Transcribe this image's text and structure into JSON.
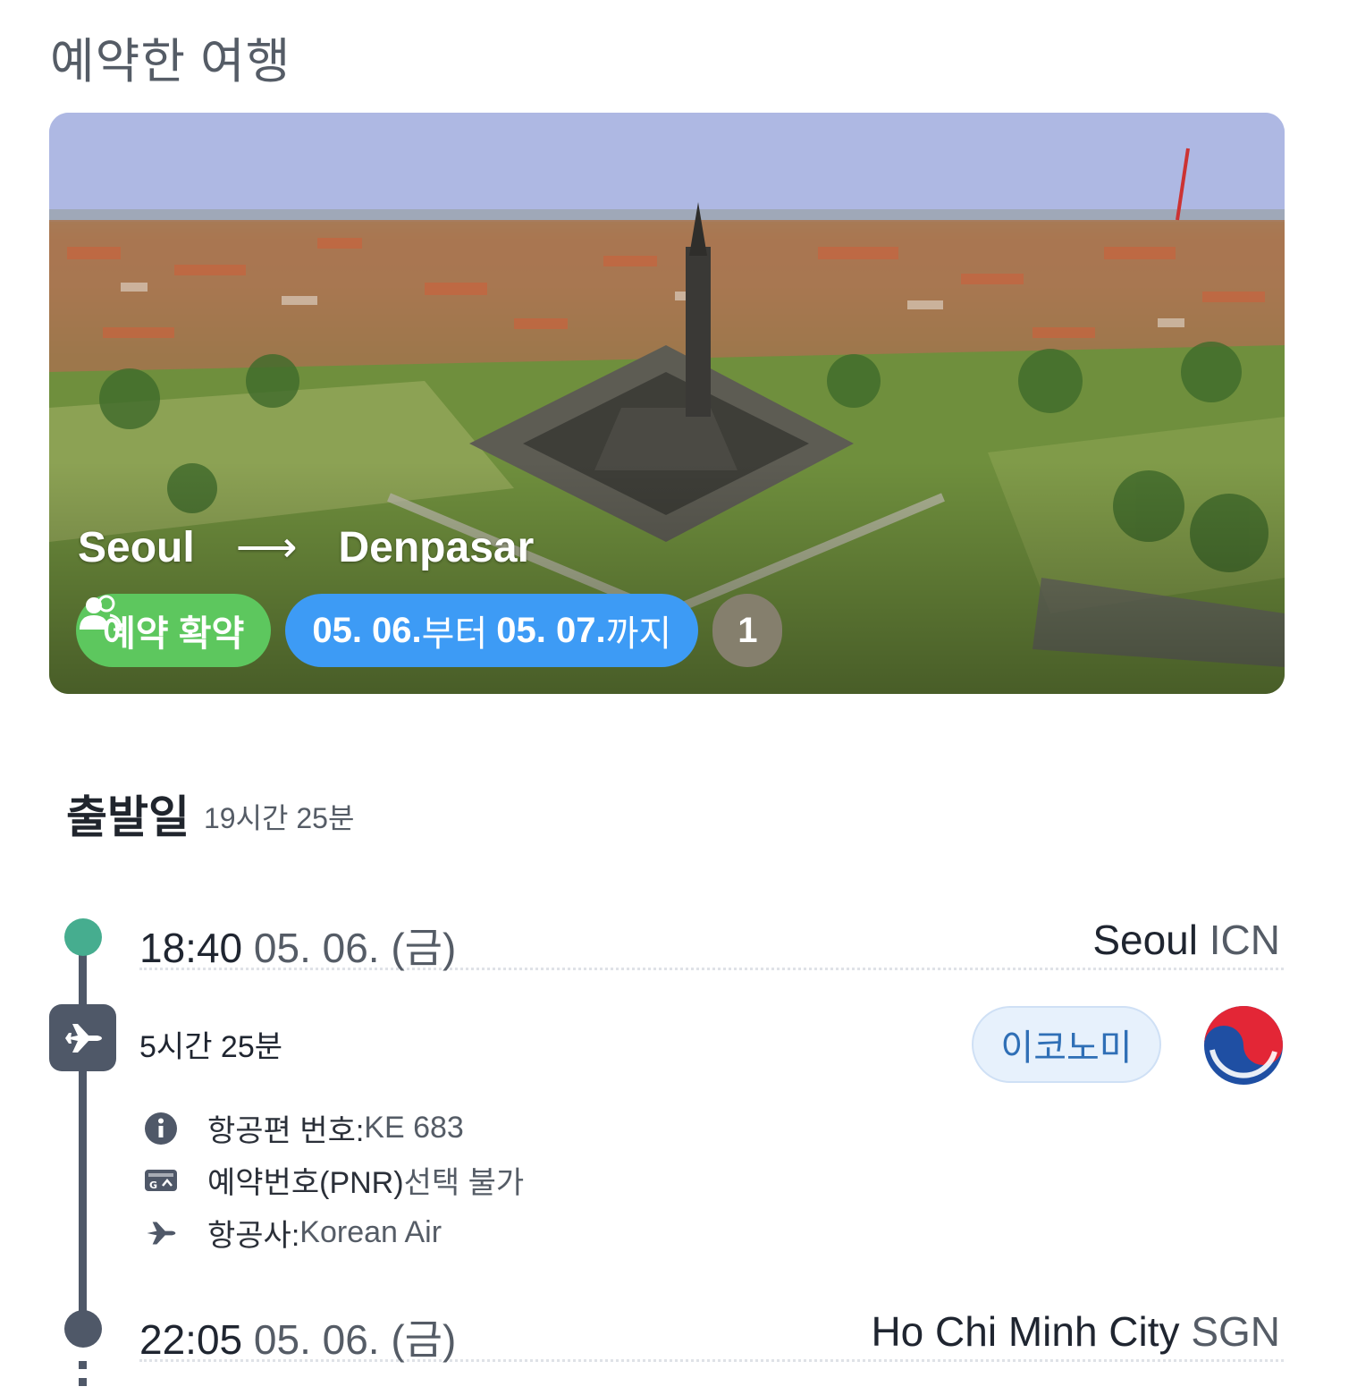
{
  "page_title": "예약한 여행",
  "trip": {
    "origin": "Seoul",
    "arrow": "⟶",
    "destination": "Denpasar",
    "status_badge": "예약 확약",
    "date_from": "05. 06.",
    "from_suffix": "부터",
    "date_to": "05. 07.",
    "to_suffix": "까지",
    "passenger_count": "1"
  },
  "section": {
    "title": "출발일",
    "duration": "19시간 25분"
  },
  "departure": {
    "time": "18:40",
    "date": "05. 06. (금)",
    "city": "Seoul",
    "code": "ICN"
  },
  "flight": {
    "duration": "5시간 25분",
    "cabin": "이코노미",
    "flight_number_label": "항공편 번호: ",
    "flight_number": "KE 683",
    "pnr_label": "예약번호(PNR) ",
    "pnr_value": "선택 불가",
    "airline_label": "항공사: ",
    "airline": "Korean Air"
  },
  "arrival": {
    "time": "22:05",
    "date": "05. 06. (금)",
    "city": "Ho Chi Minh City",
    "code": "SGN"
  },
  "colors": {
    "status_green": "#5dc75e",
    "date_blue": "#3d9bf5",
    "pax_gray": "#857f6d",
    "timeline_dot_start": "#46ad8f",
    "timeline_line": "#4f5868"
  },
  "icons": [
    "arrow-right-icon",
    "people-icon",
    "airplane-icon",
    "info-icon",
    "ticket-icon",
    "plane-small-icon",
    "korean-air-logo-icon"
  ]
}
